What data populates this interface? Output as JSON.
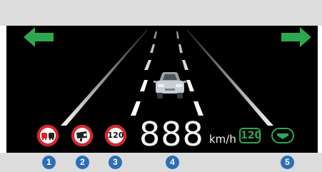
{
  "colors": {
    "display_background": "#000000",
    "accent_green": "#2ea84e",
    "sign_red": "#d8242b",
    "callout_blue": "#2d6eb5",
    "frame_gray": "#dcdcdc"
  },
  "icons": {
    "left_turn": "left-arrow-icon",
    "right_turn": "right-arrow-icon",
    "vehicle": "car-icon",
    "no_overtaking": "no-overtaking-sign-icon",
    "speed_camera": "speed-camera-sign-icon",
    "lane_keep": "lane-keeping-icon"
  },
  "signs": {
    "speed_limit": "120"
  },
  "speed": {
    "value": "888",
    "unit": "km/h"
  },
  "acc": {
    "set_speed": "120"
  },
  "callouts": [
    "1",
    "2",
    "3",
    "4",
    "5"
  ]
}
